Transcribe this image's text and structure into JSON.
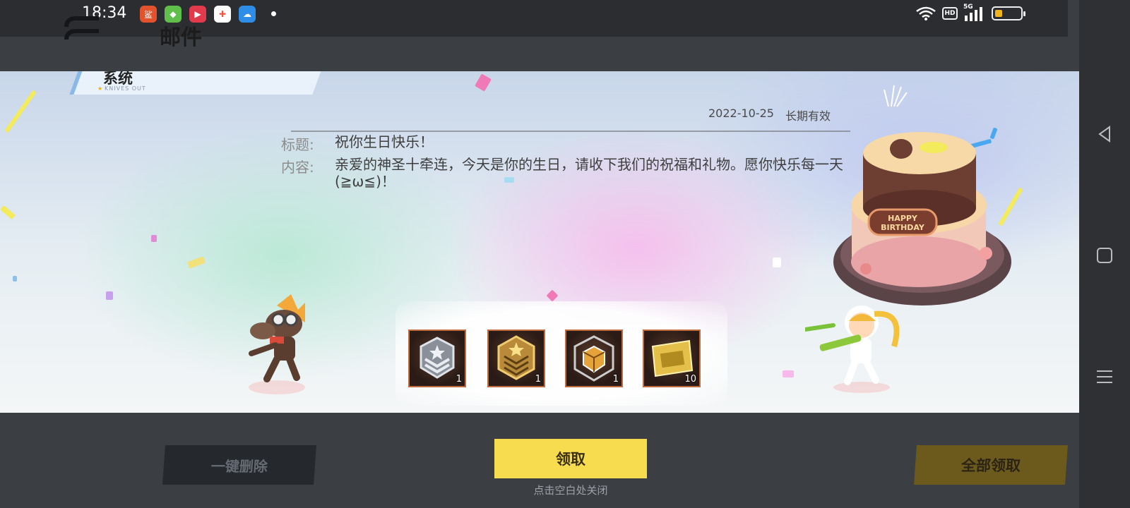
{
  "status_bar": {
    "time": "18:34",
    "hd_badge": "HD",
    "network": "5G",
    "icons": [
      "app-icon-1",
      "app-icon-2",
      "video-app-icon",
      "game-app-icon",
      "weather-app-icon",
      "wifi-icon",
      "signal-icon",
      "battery-icon"
    ],
    "battery_level": 0.3
  },
  "header": {
    "title": "邮件"
  },
  "mail": {
    "sender_tab": "系统",
    "sender_sub": "KNIVES OUT",
    "date": "2022-10-25",
    "validity": "长期有效",
    "subject_label": "标题:",
    "subject": "祝你生日快乐！",
    "content_label": "内容:",
    "content": "亲爱的神圣十牵连，今天是你的生日，请收下我们的祝福和礼物。愿你快乐每一天(≧ω≦)！",
    "cake_text": "HAPPY BIRTHDAY"
  },
  "rewards": [
    {
      "icon": "silver-rank-badge-icon",
      "count": "1"
    },
    {
      "icon": "gold-rank-badge-icon",
      "count": "1"
    },
    {
      "icon": "treasure-chest-icon",
      "count": "1"
    },
    {
      "icon": "gold-ticket-icon",
      "count": "10"
    }
  ],
  "buttons": {
    "delete_all": "一键删除",
    "claim": "领取",
    "claim_hint": "点击空白处关闭",
    "claim_all": "全部领取"
  },
  "colors": {
    "claim_button": "#f6dc4e",
    "claim_all_button": "#6c5a1d",
    "delete_button": "#25282d"
  }
}
